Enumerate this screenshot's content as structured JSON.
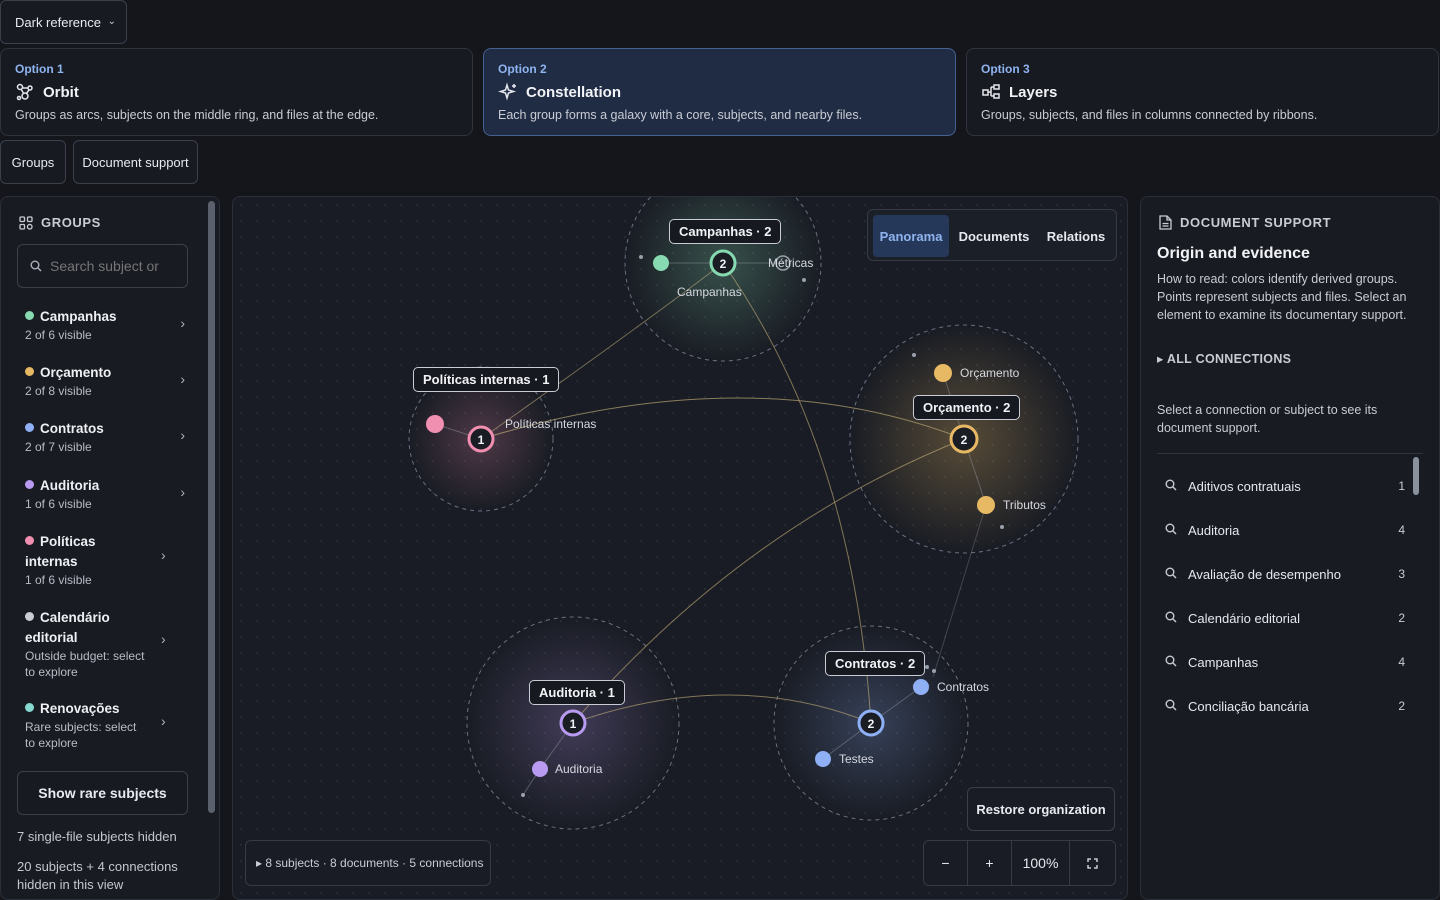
{
  "theme_select": {
    "label": "Dark reference"
  },
  "options": [
    {
      "num": "Option 1",
      "title": "Orbit",
      "desc": "Groups as arcs, subjects on the middle ring, and files at the edge.",
      "icon": "orbit-icon"
    },
    {
      "num": "Option 2",
      "title": "Constellation",
      "desc": "Each group forms a galaxy with a core, subjects, and nearby files.",
      "icon": "sparkle-icon"
    },
    {
      "num": "Option 3",
      "title": "Layers",
      "desc": "Groups, subjects, and files in columns connected by ribbons.",
      "icon": "layers-icon"
    }
  ],
  "view_buttons": {
    "groups": "Groups",
    "doc_support": "Document support"
  },
  "left": {
    "header": "GROUPS",
    "search_placeholder": "Search subject or",
    "groups": [
      {
        "name": "Campanhas",
        "sub": "2 of 6 visible",
        "color": "#86d9b0"
      },
      {
        "name": "Orçamento",
        "sub": "2 of 8 visible",
        "color": "#e8b964"
      },
      {
        "name": "Contratos",
        "sub": "2 of 7 visible",
        "color": "#8fb0f5"
      },
      {
        "name": "Auditoria",
        "sub": "1 of 6 visible",
        "color": "#b89af0"
      },
      {
        "name": "Políticas internas",
        "sub": "1 of 6 visible",
        "color": "#f08fb0"
      },
      {
        "name": "Calendário editorial",
        "sub": "Outside budget: select to explore",
        "color": "#c9ccd4"
      },
      {
        "name": "Renovações",
        "sub": "Rare subjects: select to explore",
        "color": "#86d9d0"
      }
    ],
    "rare_button": "Show rare subjects",
    "note1": "7 single-file subjects hidden",
    "note2": "20 subjects + 4 connections hidden in this view"
  },
  "center": {
    "tabs": [
      "Panorama",
      "Documents",
      "Relations"
    ],
    "clusters": {
      "campanhas": {
        "label": "Campanhas · 2",
        "core": "2",
        "core_label": "Campanhas",
        "subject": "Métricas"
      },
      "politicas": {
        "label": "Políticas internas · 1",
        "core": "1",
        "core_label": "Políticas internas"
      },
      "orcamento": {
        "label": "Orçamento · 2",
        "core": "2",
        "subject1": "Orçamento",
        "subject2": "Tributos"
      },
      "auditoria": {
        "label": "Auditoria · 1",
        "core": "1",
        "subject": "Auditoria"
      },
      "contratos": {
        "label": "Contratos · 2",
        "core": "2",
        "subject1": "Contratos",
        "subject2": "Testes"
      }
    },
    "info": "▸ 8 subjects · 8 documents · 5 connections",
    "restore": "Restore organization",
    "zoom": {
      "minus": "−",
      "plus": "+",
      "level": "100%"
    }
  },
  "right": {
    "header": "DOCUMENT SUPPORT",
    "title": "Origin and evidence",
    "how_to": "How to read: colors identify derived groups. Points represent subjects and files. Select an element to examine its documentary support.",
    "all_conn": "▸ ALL CONNECTIONS",
    "select_text": "Select a connection or subject to see its document support.",
    "items": [
      {
        "name": "Aditivos contratuais",
        "count": "1"
      },
      {
        "name": "Auditoria",
        "count": "4"
      },
      {
        "name": "Avaliação de desempenho",
        "count": "3"
      },
      {
        "name": "Calendário editorial",
        "count": "2"
      },
      {
        "name": "Campanhas",
        "count": "4"
      },
      {
        "name": "Conciliação bancária",
        "count": "2"
      }
    ]
  }
}
